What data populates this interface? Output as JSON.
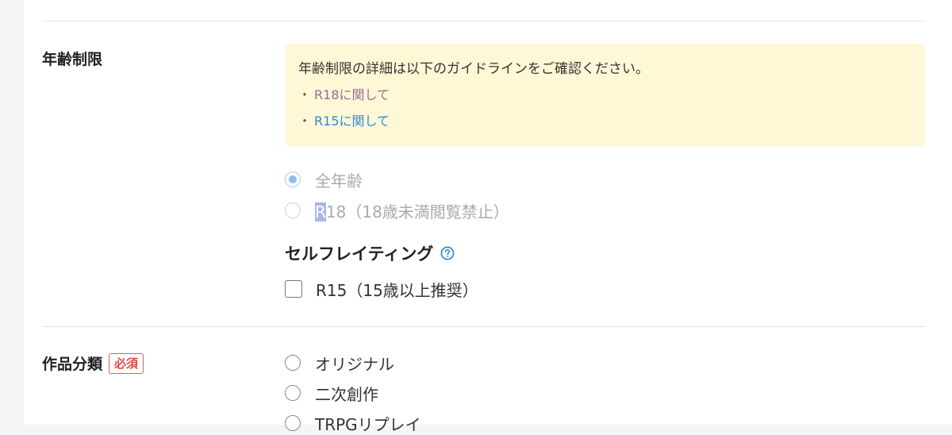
{
  "age_restriction": {
    "label": "年齢制限",
    "notice": {
      "text": "年齢制限の詳細は以下のガイドラインをご確認ください。",
      "bullet": "・",
      "links": [
        {
          "label": "R18に関して",
          "visited": true
        },
        {
          "label": "R15に関して",
          "visited": false
        }
      ]
    },
    "options": [
      {
        "label": "全年齢",
        "checked": true,
        "disabled": true
      },
      {
        "label_highlight": "R",
        "label_rest": "18（18歳未満閲覧禁止）",
        "checked": false,
        "disabled": true
      }
    ],
    "self_rating": {
      "title": "セルフレイティング",
      "help_icon": "question-circle-icon",
      "checkbox_label": "R15（15歳以上推奨）",
      "checked": false
    }
  },
  "work_category": {
    "label": "作品分類",
    "required_badge": "必須",
    "options": [
      {
        "label": "オリジナル",
        "checked": false
      },
      {
        "label": "二次創作",
        "checked": false
      },
      {
        "label": "TRPGリプレイ",
        "checked": false
      }
    ]
  },
  "colors": {
    "notice_bg": "#fff8d6",
    "link_visited": "#9a6b9a",
    "link": "#2d8ad8",
    "required": "#e04848",
    "radio_checked_disabled": "#8fbcea",
    "text_selection": "#a7b7ea"
  }
}
